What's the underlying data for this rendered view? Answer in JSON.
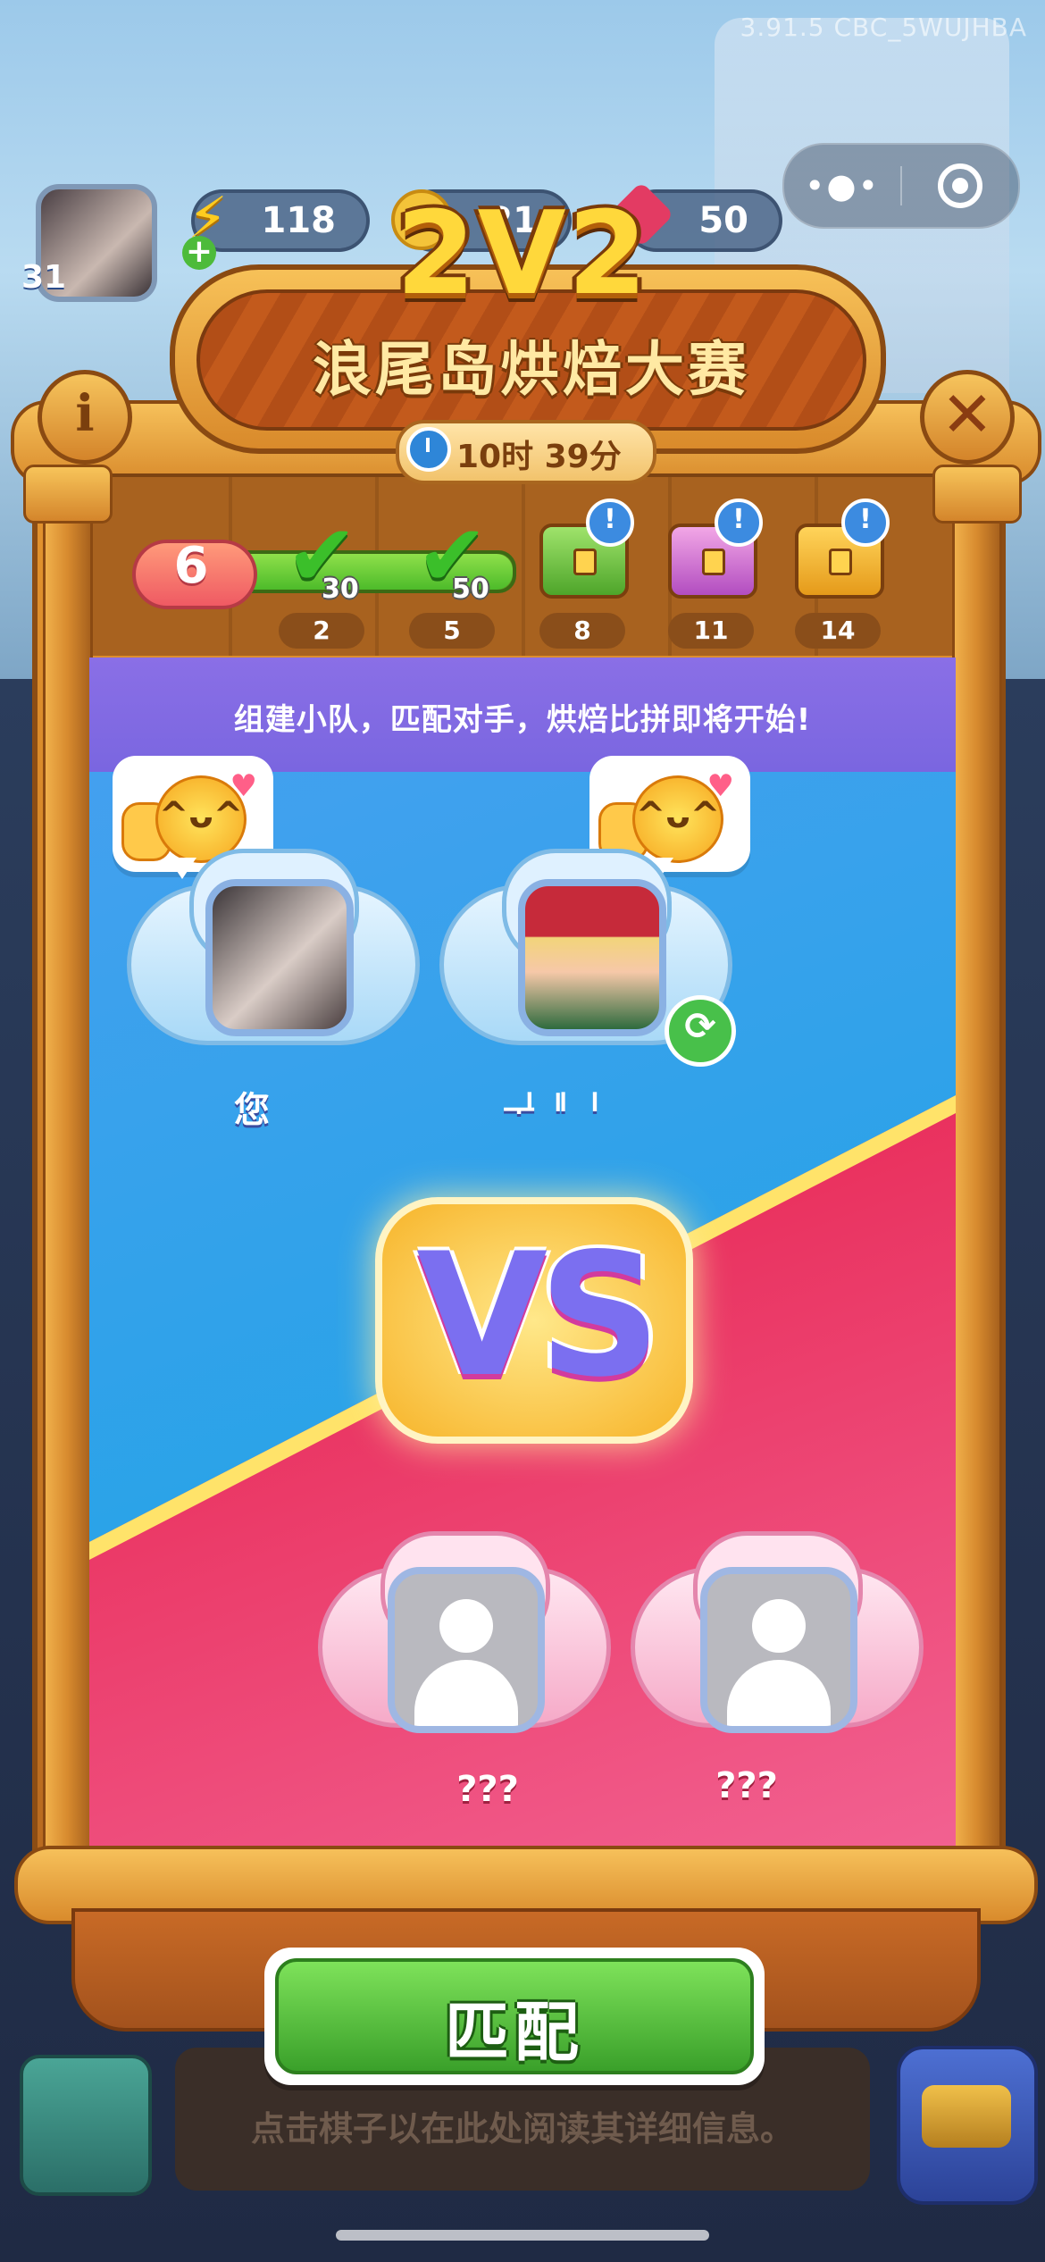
{
  "system": {
    "version_text": "3.91.5 CBC_5WUJHBA"
  },
  "capsule": {
    "more": "•●•"
  },
  "player": {
    "level": "31"
  },
  "resources": {
    "energy": "118",
    "coins": "21",
    "gems": "50"
  },
  "event": {
    "mode": "2V2",
    "title": "浪尾岛烘焙大赛",
    "timer": "10时 39分",
    "info_icon": "i",
    "close_icon": "✕"
  },
  "progress": {
    "current_rank": "6",
    "fill_fraction": 1.0,
    "milestones": [
      {
        "step": "2",
        "reward": "30",
        "state": "claimed"
      },
      {
        "step": "5",
        "reward": "50",
        "state": "claimed"
      },
      {
        "step": "8",
        "reward": "",
        "state": "chest-green"
      },
      {
        "step": "11",
        "reward": "",
        "state": "chest-pink"
      },
      {
        "step": "14",
        "reward": "",
        "state": "chest-gold"
      }
    ],
    "badge": "!"
  },
  "arena": {
    "banner": "组建小队，匹配对手，烘焙比拼即将开始!",
    "team_a": [
      {
        "name": "您"
      },
      {
        "name": "ᆛᅵᅵᅵ"
      }
    ],
    "team_b": [
      {
        "name": "???"
      },
      {
        "name": "???"
      }
    ],
    "vs": "VS"
  },
  "actions": {
    "match": "匹配"
  },
  "hint": "点击棋子以在此处阅读其详细信息。"
}
